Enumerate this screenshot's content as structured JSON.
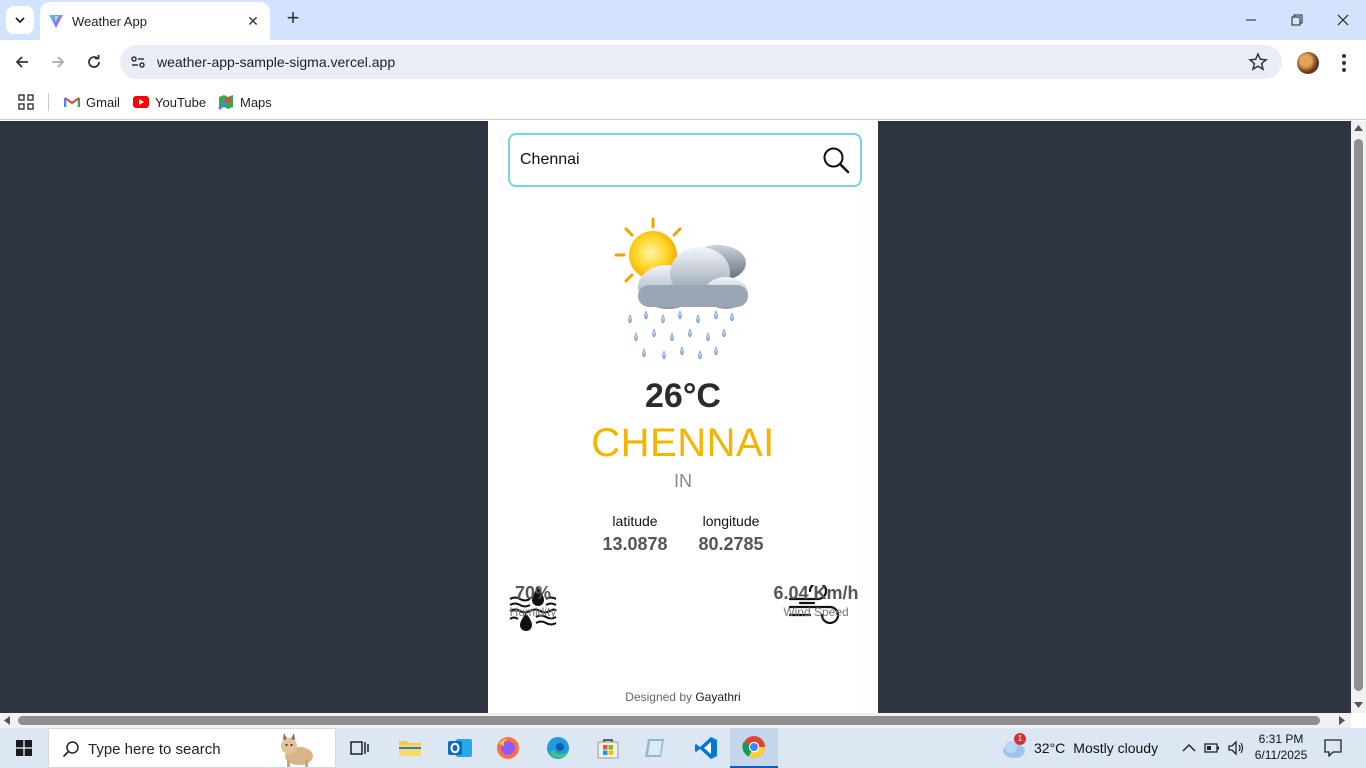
{
  "browser": {
    "tab_title": "Weather App",
    "url": "weather-app-sample-sigma.vercel.app",
    "bookmarks": [
      {
        "label": "Gmail",
        "icon": "gmail-icon"
      },
      {
        "label": "YouTube",
        "icon": "youtube-icon"
      },
      {
        "label": "Maps",
        "icon": "maps-icon"
      }
    ]
  },
  "app": {
    "search_value": "Chennai",
    "weather_icon": "sun-cloud-rain-icon",
    "temperature": "26°C",
    "city": "CHENNAI",
    "country": "IN",
    "latitude_label": "latitude",
    "latitude_value": "13.0878",
    "longitude_label": "longitude",
    "longitude_value": "80.2785",
    "humidity_value": "70%",
    "humidity_label": "Humidity",
    "wind_value": "6.04 Km/h",
    "wind_label": "Wind Speed",
    "footer_prefix": "Designed by",
    "footer_author": "Gayathri",
    "colors": {
      "page_bg": "#2e3440",
      "city_accent": "#f4b400",
      "search_border": "#77d3e3"
    }
  },
  "taskbar": {
    "search_placeholder": "Type here to search",
    "weather_temp": "32°C",
    "weather_desc": "Mostly cloudy",
    "weather_badge": "1",
    "time": "6:31 PM",
    "date": "6/11/2025"
  }
}
